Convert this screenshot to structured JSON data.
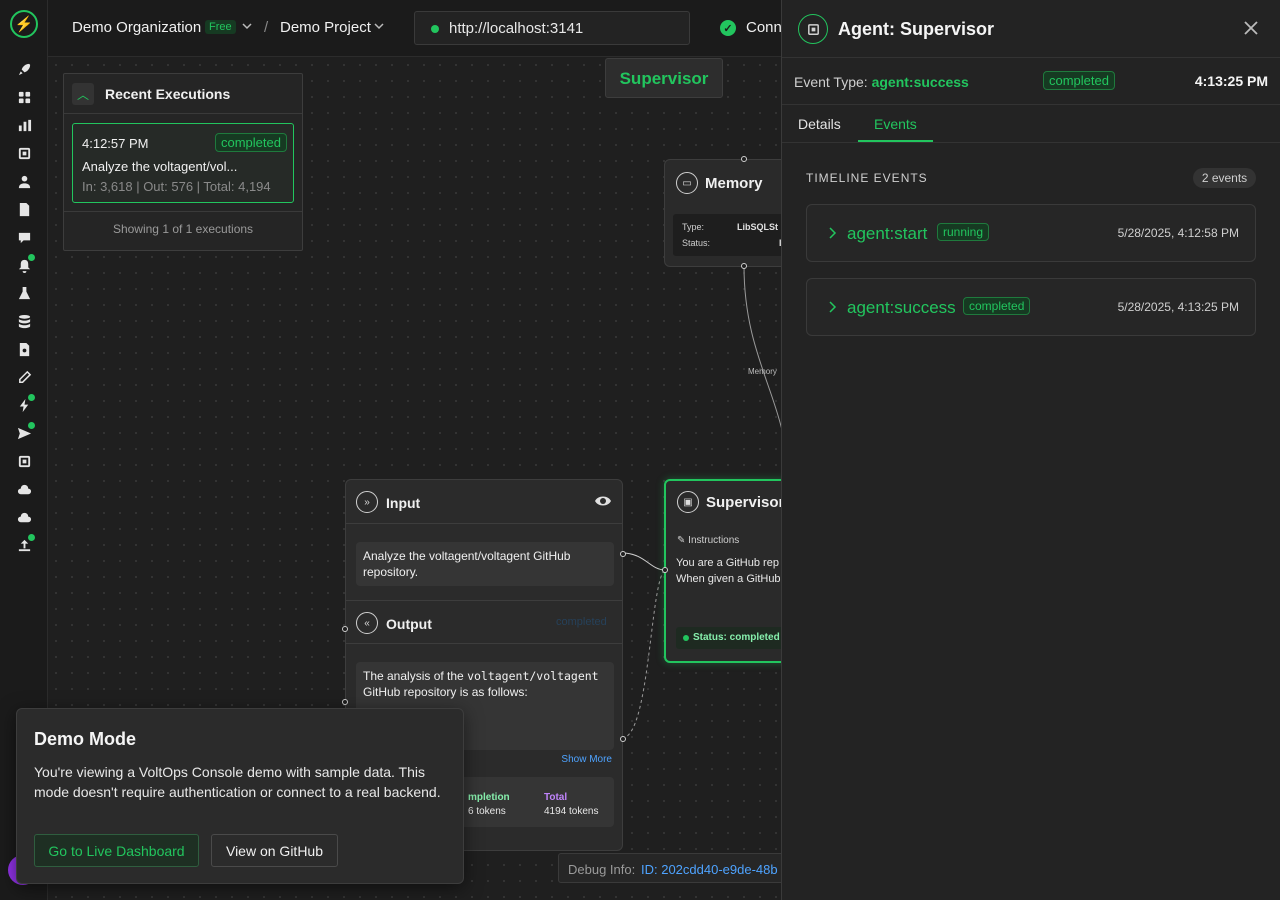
{
  "header": {
    "org": "Demo Organization",
    "plan_badge": "Free",
    "separator": "/",
    "project": "Demo Project",
    "url": "http://localhost:3141",
    "connection": "Conn"
  },
  "recent": {
    "title": "Recent Executions",
    "item": {
      "time": "4:12:57 PM",
      "status": "completed",
      "description": "Analyze the voltagent/vol...",
      "tokens": "In: 3,618 | Out: 576 | Total: 4,194"
    },
    "footer": "Showing 1 of 1 executions"
  },
  "canvas": {
    "supervisor_label": "Supervisor",
    "memory": {
      "title": "Memory",
      "type_label": "Type:",
      "type_value": "LibSQLSt",
      "status_label": "Status:",
      "status_value": "I",
      "edge_label": "Memory"
    },
    "input": {
      "title": "Input",
      "text": "Analyze the voltagent/voltagent GitHub repository."
    },
    "output": {
      "title": "Output",
      "status": "completed",
      "text_prefix": "The analysis of the ",
      "text_code": "voltagent/voltagent",
      "text_suffix": " GitHub repository is as follows:",
      "show_more": "Show More",
      "completion_label": "mpletion",
      "completion_value": "6 tokens",
      "total_label": "Total",
      "total_value": "4194 tokens"
    },
    "supervisor_node": {
      "title": "Supervisor",
      "instructions": "Instructions",
      "text_line1": "You are a GitHub rep",
      "text_line2": "When given a GitHub",
      "status": "Status: completed"
    },
    "debug": {
      "label": "Debug Info:",
      "value": "ID: 202cdd40-e9de-48b"
    }
  },
  "demo": {
    "title": "Demo Mode",
    "text": "You're viewing a VoltOps Console demo with sample data. This mode doesn't require authentication or connect to a real backend.",
    "live_button": "Go to Live Dashboard",
    "github_button": "View on GitHub"
  },
  "panel": {
    "title": "Agent: Supervisor",
    "event_type_label": "Event Type:",
    "event_type_value": "agent:success",
    "status": "completed",
    "time": "4:13:25 PM",
    "tabs": [
      {
        "label": "Details",
        "active": false
      },
      {
        "label": "Events",
        "active": true
      }
    ],
    "timeline_title": "TIMELINE EVENTS",
    "timeline_count": "2 events",
    "events": [
      {
        "name": "agent:start",
        "status": "running",
        "date": "5/28/2025, 4:12:58 PM"
      },
      {
        "name": "agent:success",
        "status": "completed",
        "date": "5/28/2025, 4:13:25 PM"
      }
    ]
  },
  "colors": {
    "accent": "#22c55e",
    "background": "#1b1b1b",
    "link": "#4ea3ff",
    "avatar": "#9333ea"
  }
}
